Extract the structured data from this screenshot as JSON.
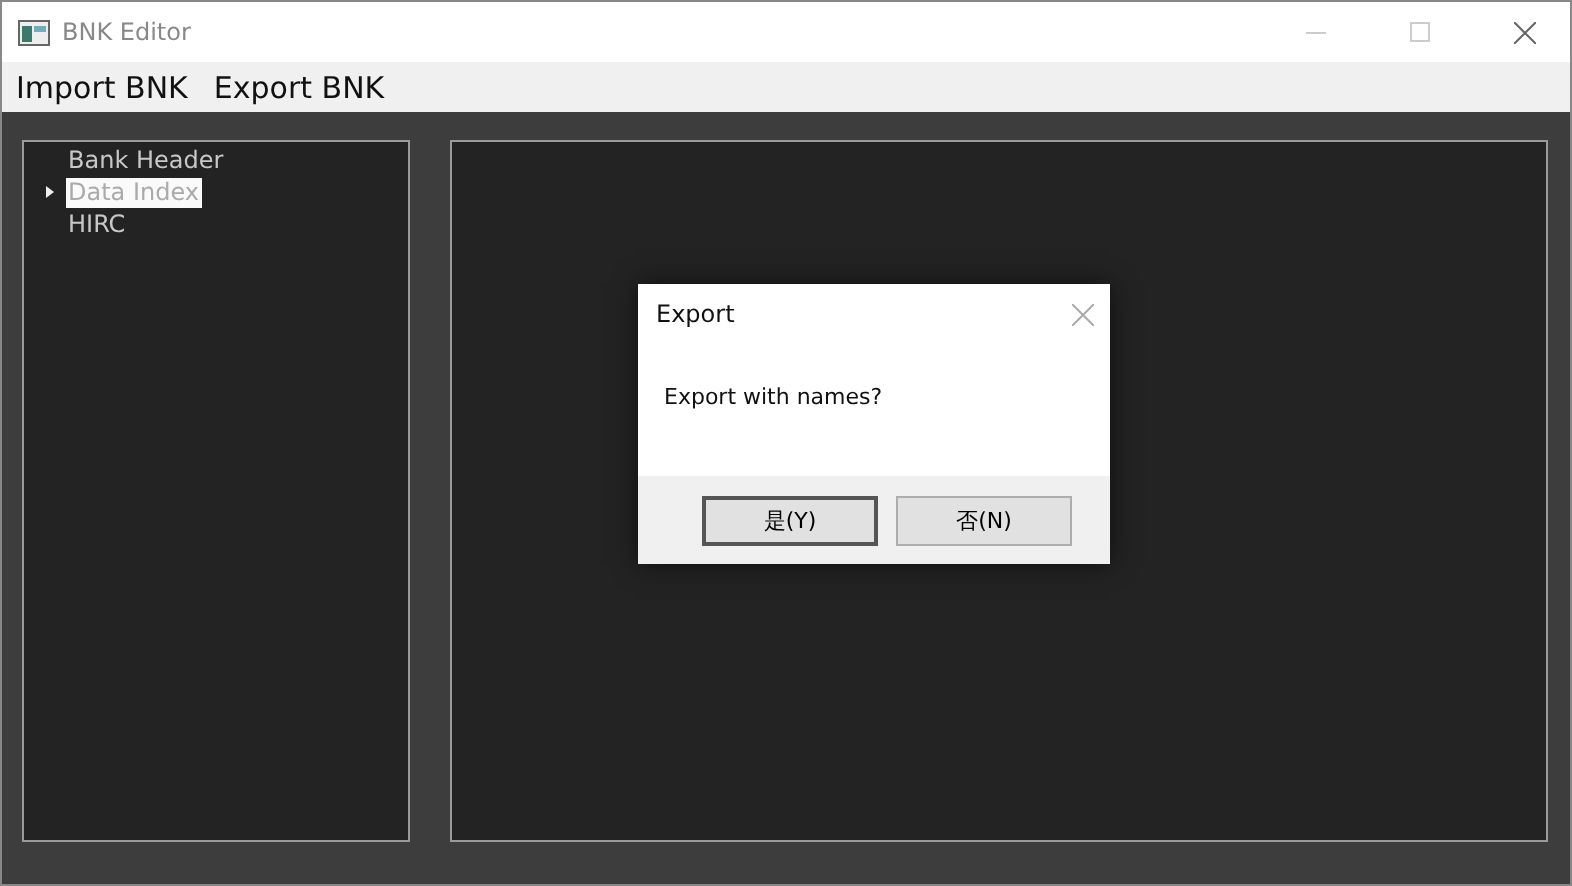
{
  "window": {
    "title": "BNK Editor"
  },
  "menu": [
    "Import BNK",
    "Export BNK"
  ],
  "tree": [
    {
      "label": "Bank Header",
      "selected": false
    },
    {
      "label": "Data Index",
      "selected": true,
      "expanded": false
    },
    {
      "label": "HIRC",
      "selected": false
    }
  ],
  "dialog": {
    "title": "Export",
    "message": "Export with names?",
    "buttons": [
      {
        "label": "是(Y)",
        "default": true
      },
      {
        "label": "否(N)",
        "default": false
      }
    ]
  }
}
